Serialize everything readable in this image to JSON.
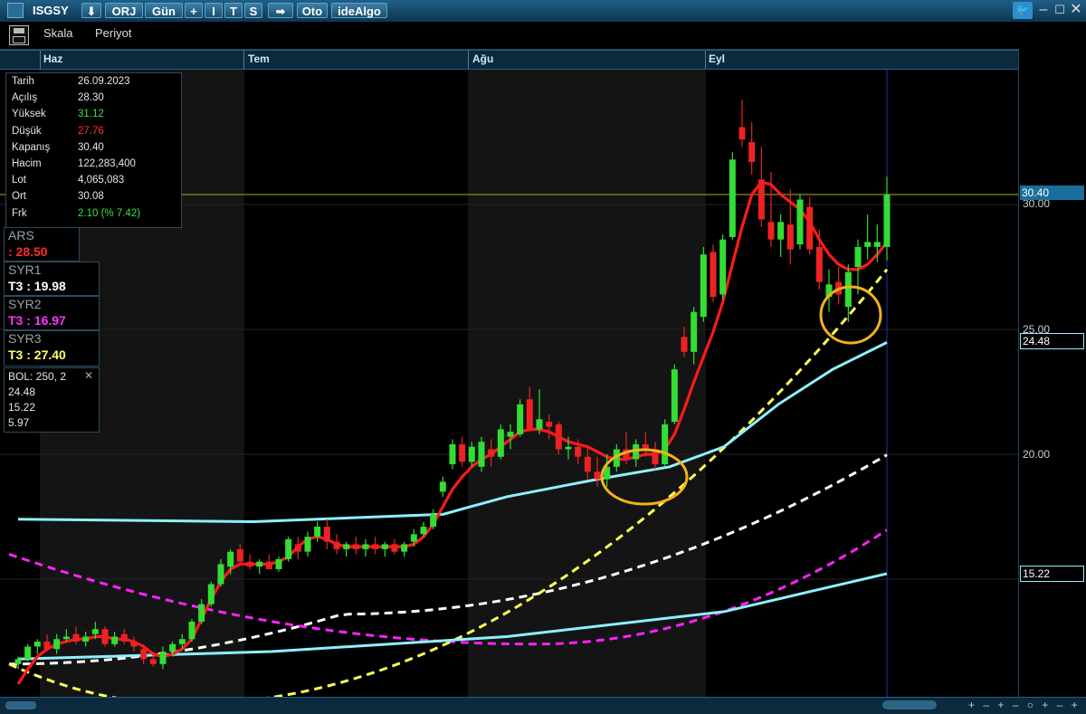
{
  "toolbar": {
    "symbol": "ISGSY",
    "down_icon": "⬇",
    "orj": "ORJ",
    "period": "Gün",
    "plus": "+",
    "i": "I",
    "t": "T",
    "s": "S",
    "arrow_icon": "➡",
    "oto": "Oto",
    "idealgo": "ideAlgo",
    "skala": "Skala",
    "periyot": "Periyot"
  },
  "months": [
    "Haz",
    "Tem",
    "Ağu",
    "Eyl"
  ],
  "info": [
    {
      "k": "Tarih",
      "v": "26.09.2023",
      "color": "#e6e6e6"
    },
    {
      "k": "Açılış",
      "v": "28.30",
      "color": "#e6e6e6"
    },
    {
      "k": "Yüksek",
      "v": "31.12",
      "color": "#39e639"
    },
    {
      "k": "Düşük",
      "v": "27.76",
      "color": "#ff3030"
    },
    {
      "k": "Kapanış",
      "v": "30.40",
      "color": "#e6e6e6"
    },
    {
      "k": "Hacim",
      "v": "122,283,400",
      "color": "#e6e6e6"
    },
    {
      "k": "Lot",
      "v": "4,065,083",
      "color": "#e6e6e6"
    },
    {
      "k": "Ort",
      "v": "30.08",
      "color": "#e6e6e6"
    },
    {
      "k": "Frk",
      "v": "2.10 (% 7.42)",
      "color": "#39e639"
    }
  ],
  "indicators": {
    "ars": {
      "name": "ARS",
      "value": ": 28.50",
      "color": "#ff2a2a"
    },
    "syr1": {
      "name": "SYR1",
      "value": "T3 :  19.98",
      "color": "#ffffff"
    },
    "syr2": {
      "name": "SYR2",
      "value": "T3 :  16.97",
      "color": "#ff33ff"
    },
    "syr3": {
      "name": "SYR3",
      "value": "T3 :  27.40",
      "color": "#ffff66"
    },
    "bol": {
      "name": "BOL: 250, 2",
      "close_icon": "✕",
      "upper": "24.48",
      "middle": "15.22",
      "lower": "5.97"
    }
  },
  "price_axis": {
    "labels": [
      "30.00",
      "25.00",
      "20.00"
    ],
    "current": "30.40",
    "bol_upper": "24.48",
    "bol_middle": "15.22"
  },
  "colors": {
    "up": "#33dd33",
    "down": "#ee2222",
    "ars": "#ff1a1a",
    "syr1": "#ffffff",
    "syr2": "#ff22ff",
    "syr3": "#ffff55",
    "bollinger": "#8ff0ff",
    "highlight": "#f2b21c",
    "last_price_line": "#9a9a2a"
  },
  "chart_data": {
    "type": "candlestick",
    "title": "ISGSY",
    "ylim": [
      9.6,
      34.4
    ],
    "x_months": [
      "Haz",
      "Tem",
      "Ağu",
      "Eyl"
    ],
    "candles": [
      [
        11.6,
        11.9,
        11.4,
        11.8
      ],
      [
        11.8,
        12.4,
        11.7,
        12.3
      ],
      [
        12.3,
        12.6,
        12.0,
        12.5
      ],
      [
        12.5,
        12.8,
        12.1,
        12.2
      ],
      [
        12.2,
        12.8,
        12.0,
        12.6
      ],
      [
        12.6,
        13.0,
        12.5,
        12.7
      ],
      [
        12.8,
        13.1,
        12.4,
        12.5
      ],
      [
        12.5,
        12.9,
        12.3,
        12.7
      ],
      [
        12.8,
        13.3,
        12.6,
        13.0
      ],
      [
        13.0,
        13.1,
        12.3,
        12.4
      ],
      [
        12.4,
        12.9,
        12.3,
        12.7
      ],
      [
        12.8,
        13.0,
        12.4,
        12.5
      ],
      [
        12.5,
        12.7,
        12.1,
        12.3
      ],
      [
        12.2,
        12.4,
        11.6,
        11.8
      ],
      [
        11.8,
        12.1,
        11.5,
        11.6
      ],
      [
        11.6,
        12.3,
        11.4,
        12.1
      ],
      [
        12.1,
        12.5,
        11.9,
        12.4
      ],
      [
        12.4,
        12.8,
        12.2,
        12.6
      ],
      [
        12.6,
        13.4,
        12.5,
        13.3
      ],
      [
        13.3,
        14.2,
        13.2,
        14.0
      ],
      [
        14.0,
        14.9,
        13.9,
        14.8
      ],
      [
        14.8,
        15.8,
        14.7,
        15.6
      ],
      [
        15.5,
        16.2,
        15.2,
        16.1
      ],
      [
        16.2,
        16.4,
        15.6,
        15.7
      ],
      [
        15.7,
        16.0,
        15.4,
        15.5
      ],
      [
        15.5,
        15.8,
        15.2,
        15.7
      ],
      [
        15.7,
        16.0,
        15.4,
        15.4
      ],
      [
        15.4,
        15.9,
        15.3,
        15.8
      ],
      [
        15.8,
        16.7,
        15.7,
        16.6
      ],
      [
        16.4,
        16.7,
        15.8,
        16.1
      ],
      [
        16.1,
        16.9,
        15.9,
        16.7
      ],
      [
        16.7,
        17.3,
        16.5,
        17.1
      ],
      [
        17.1,
        17.4,
        16.2,
        16.5
      ],
      [
        16.5,
        16.8,
        16.0,
        16.2
      ],
      [
        16.2,
        16.5,
        15.9,
        16.4
      ],
      [
        16.4,
        16.7,
        16.0,
        16.2
      ],
      [
        16.2,
        16.6,
        15.9,
        16.4
      ],
      [
        16.4,
        16.7,
        16.0,
        16.2
      ],
      [
        16.2,
        16.5,
        15.9,
        16.4
      ],
      [
        16.4,
        16.6,
        16.0,
        16.1
      ],
      [
        16.1,
        16.5,
        15.9,
        16.4
      ],
      [
        16.5,
        17.0,
        16.3,
        16.8
      ],
      [
        16.8,
        17.3,
        16.7,
        17.1
      ],
      [
        17.1,
        17.8,
        17.0,
        17.6
      ],
      [
        18.5,
        19.1,
        18.3,
        18.9
      ],
      [
        19.6,
        20.6,
        19.4,
        20.4
      ],
      [
        20.4,
        20.7,
        19.5,
        19.7
      ],
      [
        19.7,
        20.5,
        19.5,
        20.3
      ],
      [
        19.5,
        20.7,
        19.3,
        20.5
      ],
      [
        20.2,
        20.6,
        19.5,
        19.9
      ],
      [
        19.9,
        21.2,
        19.8,
        21.0
      ],
      [
        20.7,
        21.2,
        20.2,
        20.9
      ],
      [
        20.8,
        22.2,
        20.7,
        22.0
      ],
      [
        22.2,
        22.7,
        20.9,
        21.0
      ],
      [
        21.0,
        22.6,
        20.8,
        21.4
      ],
      [
        21.3,
        21.6,
        20.6,
        21.1
      ],
      [
        21.2,
        21.3,
        20.0,
        20.2
      ],
      [
        20.2,
        20.7,
        19.8,
        20.3
      ],
      [
        20.3,
        20.6,
        19.6,
        19.9
      ],
      [
        19.9,
        20.3,
        19.0,
        19.3
      ],
      [
        19.3,
        19.9,
        18.7,
        19.0
      ],
      [
        19.0,
        20.0,
        18.7,
        19.5
      ],
      [
        19.5,
        20.4,
        19.3,
        20.2
      ],
      [
        20.2,
        20.9,
        19.6,
        19.8
      ],
      [
        19.8,
        20.6,
        19.5,
        20.4
      ],
      [
        20.4,
        20.9,
        19.9,
        20.2
      ],
      [
        20.2,
        20.5,
        19.4,
        19.6
      ],
      [
        19.6,
        21.4,
        19.5,
        21.2
      ],
      [
        21.3,
        23.6,
        21.2,
        23.4
      ],
      [
        24.7,
        25.1,
        23.9,
        24.1
      ],
      [
        24.1,
        25.9,
        23.6,
        25.7
      ],
      [
        25.5,
        28.3,
        25.3,
        28.0
      ],
      [
        28.1,
        28.4,
        26.1,
        26.3
      ],
      [
        26.4,
        28.8,
        26.2,
        28.6
      ],
      [
        28.7,
        32.1,
        28.6,
        31.8
      ],
      [
        33.1,
        34.2,
        32.3,
        32.6
      ],
      [
        32.5,
        33.3,
        31.2,
        31.7
      ],
      [
        31.0,
        32.3,
        29.1,
        29.4
      ],
      [
        29.3,
        31.3,
        28.3,
        28.6
      ],
      [
        28.6,
        29.6,
        27.9,
        29.3
      ],
      [
        29.2,
        30.6,
        27.6,
        28.2
      ],
      [
        28.4,
        30.4,
        28.2,
        30.2
      ],
      [
        29.9,
        30.3,
        28.0,
        28.2
      ],
      [
        28.3,
        29.0,
        26.6,
        26.9
      ],
      [
        26.3,
        27.4,
        25.7,
        26.8
      ],
      [
        26.9,
        27.5,
        26.0,
        26.4
      ],
      [
        25.9,
        27.6,
        25.3,
        27.3
      ],
      [
        27.5,
        28.6,
        26.4,
        28.3
      ],
      [
        28.3,
        29.6,
        27.8,
        28.5
      ],
      [
        28.3,
        29.2,
        27.7,
        28.5
      ],
      [
        28.3,
        31.12,
        27.76,
        30.4
      ]
    ],
    "ars": [
      10.8,
      11.4,
      11.9,
      12.2,
      12.4,
      12.5,
      12.6,
      12.6,
      12.7,
      12.7,
      12.6,
      12.6,
      12.5,
      12.3,
      12.0,
      11.9,
      12.0,
      12.2,
      12.6,
      13.4,
      14.2,
      14.9,
      15.4,
      15.6,
      15.6,
      15.6,
      15.6,
      15.7,
      15.9,
      16.3,
      16.6,
      16.7,
      16.6,
      16.4,
      16.3,
      16.3,
      16.3,
      16.3,
      16.3,
      16.3,
      16.3,
      16.4,
      16.7,
      17.2,
      17.9,
      18.6,
      19.1,
      19.5,
      19.8,
      20.0,
      20.3,
      20.6,
      20.9,
      21.0,
      21.0,
      20.9,
      20.7,
      20.5,
      20.4,
      20.3,
      20.1,
      19.9,
      19.8,
      19.8,
      19.9,
      20.0,
      20.0,
      20.2,
      20.8,
      21.8,
      22.9,
      23.9,
      24.9,
      26.1,
      27.6,
      29.1,
      30.4,
      30.9,
      30.8,
      30.4,
      30.1,
      29.8,
      29.3,
      28.6,
      28.0,
      27.6,
      27.4,
      27.4,
      27.6,
      28.0,
      28.5
    ],
    "syr1_end": 19.98,
    "syr2_end": 16.97,
    "syr3_end": 27.4,
    "bollinger": {
      "upper_end": 24.48,
      "middle_end": 15.22,
      "lower_end": 5.97
    },
    "current_price": 30.4
  }
}
